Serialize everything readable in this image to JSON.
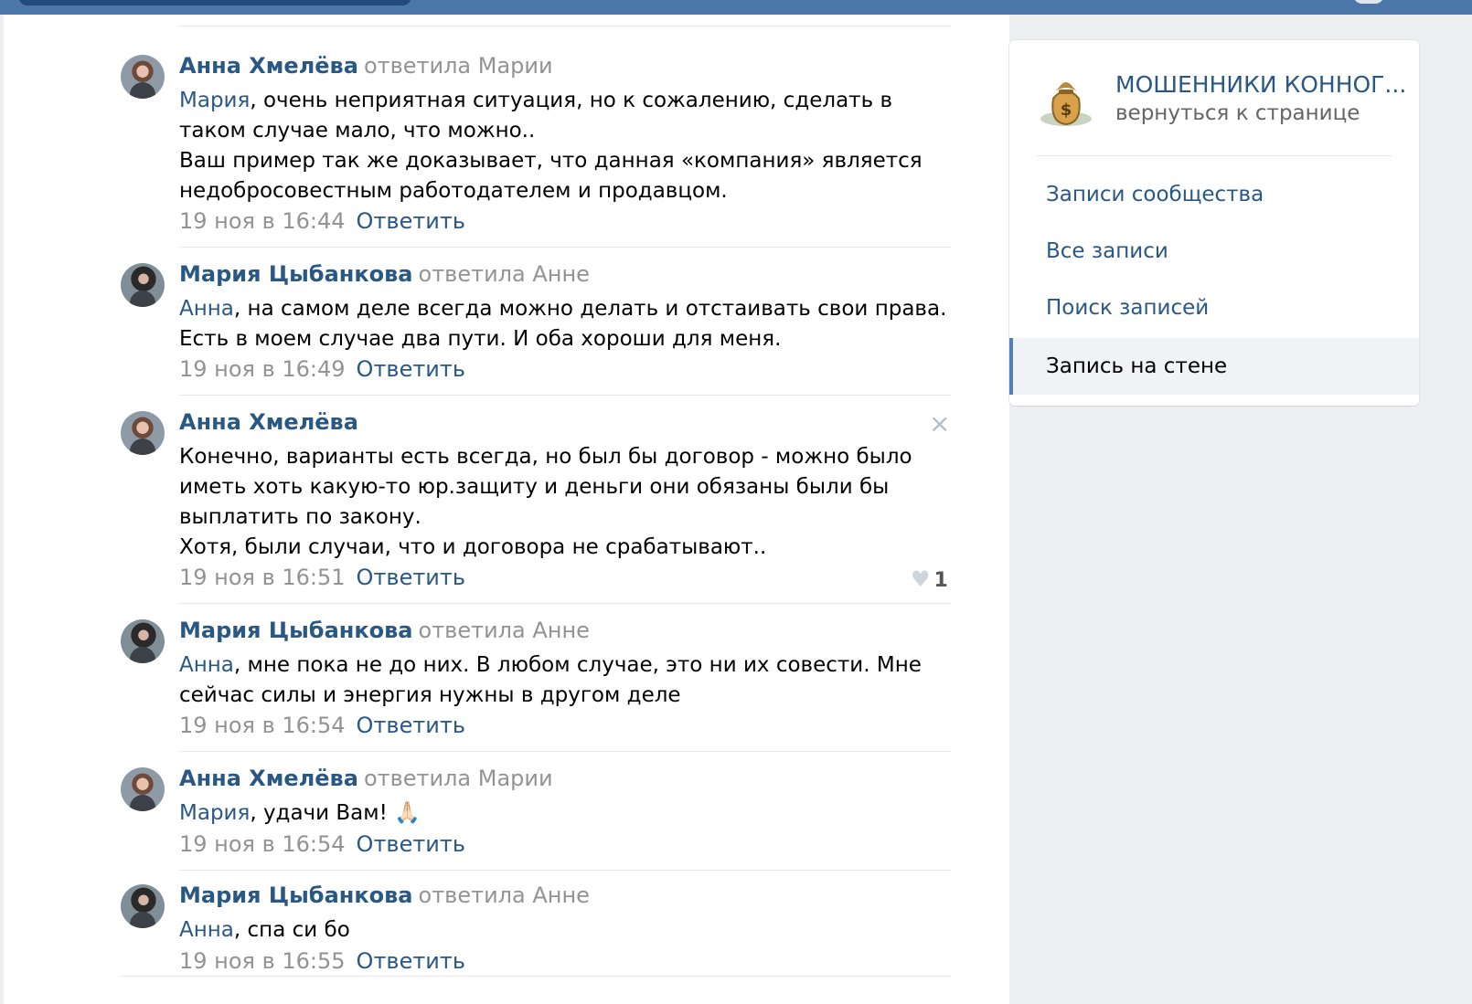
{
  "header": {},
  "comments": [
    {
      "author": "Анна Хмелёва",
      "replied_to": "ответила Марии",
      "mention": "Мария",
      "text_after_mention": ", очень неприятная ситуация, но к сожалению, сделать в таком случае мало, что можно..",
      "text_line2": "Ваш пример так же доказывает, что данная «компания» является недобросовестным работодателем и продавцом.",
      "time": "19 ноя в 16:44",
      "reply_label": "Ответить"
    },
    {
      "author": "Мария Цыбанкова",
      "replied_to": "ответила Анне",
      "mention": "Анна",
      "text_after_mention": ", на самом деле всегда можно делать и отстаивать свои права. Есть в моем случае два пути. И оба хороши для меня.",
      "time": "19 ноя в 16:49",
      "reply_label": "Ответить"
    },
    {
      "author": "Анна Хмелёва",
      "text_line1": "Конечно, варианты есть всегда, но был бы договор - можно было иметь хоть какую-то юр.защиту и деньги они обязаны были бы выплатить по закону.",
      "text_line2": "Хотя, были случаи, что и договора не срабатывают..",
      "time": "19 ноя в 16:51",
      "reply_label": "Ответить",
      "close_icon": "×",
      "likes": "1",
      "heart_icon": "♥"
    },
    {
      "author": "Мария Цыбанкова",
      "replied_to": "ответила Анне",
      "mention": "Анна",
      "text_after_mention": ", мне пока не до них. В любом случае, это ни их совести. Мне сейчас силы и энергия нужны в другом деле",
      "time": "19 ноя в 16:54",
      "reply_label": "Ответить"
    },
    {
      "author": "Анна Хмелёва",
      "replied_to": "ответила Марии",
      "mention": "Мария",
      "text_after_mention": ", удачи Вам! 🙏🏻",
      "time": "19 ноя в 16:54",
      "reply_label": "Ответить"
    },
    {
      "author": "Мария Цыбанкова",
      "replied_to": "ответила Анне",
      "mention": "Анна",
      "text_after_mention": ", спа си бо",
      "time": "19 ноя в 16:55",
      "reply_label": "Ответить"
    }
  ],
  "sidebar": {
    "group_name": "МОШЕННИКИ КОННОГ...",
    "back_link": "вернуться к странице",
    "nav": [
      {
        "label": "Записи сообщества"
      },
      {
        "label": "Все записи"
      },
      {
        "label": "Поиск записей"
      },
      {
        "label": "Запись на стене",
        "active": true
      }
    ]
  },
  "colors": {
    "link": "#2a5885",
    "topbar": "#4a76a8",
    "muted": "#939393"
  }
}
